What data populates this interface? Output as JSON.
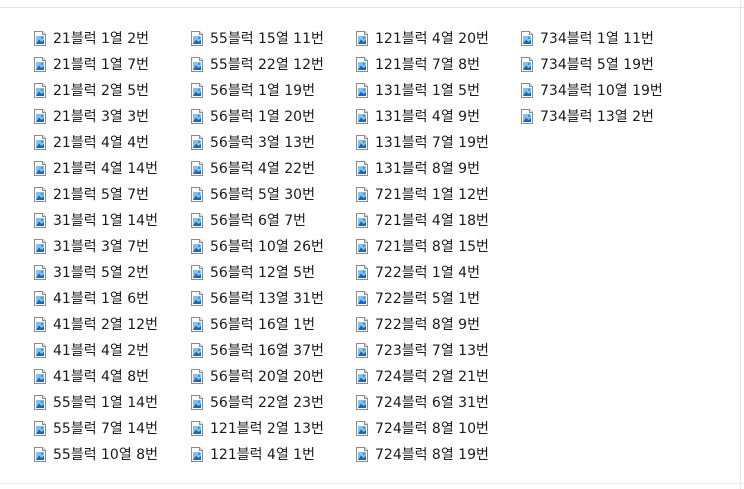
{
  "files": {
    "columns": [
      [
        {
          "name": "21블럭 1열 2번",
          "icon": "image-file-icon"
        },
        {
          "name": "21블럭 1열 7번",
          "icon": "image-file-icon"
        },
        {
          "name": "21블럭 2열 5번",
          "icon": "image-file-icon"
        },
        {
          "name": "21블럭 3열 3번",
          "icon": "image-file-icon"
        },
        {
          "name": "21블럭 4열 4번",
          "icon": "image-file-icon"
        },
        {
          "name": "21블럭 4열 14번",
          "icon": "image-file-icon"
        },
        {
          "name": "21블럭 5열 7번",
          "icon": "image-file-icon"
        },
        {
          "name": "31블럭 1열 14번",
          "icon": "image-file-icon"
        },
        {
          "name": "31블럭 3열 7번",
          "icon": "image-file-icon"
        },
        {
          "name": "31블럭 5열 2번",
          "icon": "image-file-icon"
        },
        {
          "name": "41블럭 1열 6번",
          "icon": "image-file-icon"
        },
        {
          "name": "41블럭 2열 12번",
          "icon": "image-file-icon"
        },
        {
          "name": "41블럭 4열 2번",
          "icon": "image-file-icon"
        },
        {
          "name": "41블럭 4열 8번",
          "icon": "image-file-icon"
        },
        {
          "name": "55블럭 1열 14번",
          "icon": "image-file-icon"
        },
        {
          "name": "55블럭 7열 14번",
          "icon": "image-file-icon"
        },
        {
          "name": "55블럭 10열 8번",
          "icon": "image-file-icon"
        }
      ],
      [
        {
          "name": "55블럭 15열 11번",
          "icon": "image-file-icon"
        },
        {
          "name": "55블럭 22열 12번",
          "icon": "image-file-icon"
        },
        {
          "name": "56블럭 1열 19번",
          "icon": "image-file-icon"
        },
        {
          "name": "56블럭 1열 20번",
          "icon": "image-file-icon"
        },
        {
          "name": "56블럭 3열 13번",
          "icon": "image-file-icon"
        },
        {
          "name": "56블럭 4열 22번",
          "icon": "image-file-icon"
        },
        {
          "name": "56블럭 5열 30번",
          "icon": "image-file-icon"
        },
        {
          "name": "56블럭 6열 7번",
          "icon": "image-file-icon"
        },
        {
          "name": "56블럭 10열 26번",
          "icon": "image-file-icon"
        },
        {
          "name": "56블럭 12열 5번",
          "icon": "image-file-icon"
        },
        {
          "name": "56블럭 13열 31번",
          "icon": "image-file-icon"
        },
        {
          "name": "56블럭 16열 1번",
          "icon": "image-file-icon"
        },
        {
          "name": "56블럭 16열 37번",
          "icon": "image-file-icon"
        },
        {
          "name": "56블럭 20열 20번",
          "icon": "image-file-icon"
        },
        {
          "name": "56블럭 22열 23번",
          "icon": "image-file-icon"
        },
        {
          "name": "121블럭 2열 13번",
          "icon": "image-file-icon"
        },
        {
          "name": "121블럭 4열 1번",
          "icon": "image-file-icon"
        }
      ],
      [
        {
          "name": "121블럭 4열 20번",
          "icon": "image-file-icon"
        },
        {
          "name": "121블럭 7열 8번",
          "icon": "image-file-icon"
        },
        {
          "name": "131블럭 1열 5번",
          "icon": "image-file-icon"
        },
        {
          "name": "131블럭 4열 9번",
          "icon": "image-file-icon"
        },
        {
          "name": "131블럭 7열 19번",
          "icon": "image-file-icon"
        },
        {
          "name": "131블럭 8열 9번",
          "icon": "image-file-icon"
        },
        {
          "name": "721블럭 1열 12번",
          "icon": "image-file-icon"
        },
        {
          "name": "721블럭 4열 18번",
          "icon": "image-file-icon"
        },
        {
          "name": "721블럭 8열 15번",
          "icon": "image-file-icon"
        },
        {
          "name": "722블럭 1열 4번",
          "icon": "image-file-icon"
        },
        {
          "name": "722블럭 5열 1번",
          "icon": "image-file-icon"
        },
        {
          "name": "722블럭 8열 9번",
          "icon": "image-file-icon"
        },
        {
          "name": "723블럭 7열 13번",
          "icon": "image-file-icon"
        },
        {
          "name": "724블럭 2열 21번",
          "icon": "image-file-icon"
        },
        {
          "name": "724블럭 6열 31번",
          "icon": "image-file-icon"
        },
        {
          "name": "724블럭 8열 10번",
          "icon": "image-file-icon"
        },
        {
          "name": "724블럭 8열 19번",
          "icon": "image-file-icon"
        }
      ],
      [
        {
          "name": "734블럭 1열 11번",
          "icon": "image-file-icon"
        },
        {
          "name": "734블럭 5열 19번",
          "icon": "image-file-icon"
        },
        {
          "name": "734블럭 10열 19번",
          "icon": "image-file-icon"
        },
        {
          "name": "734블럭 13열 2번",
          "icon": "image-file-icon"
        }
      ]
    ]
  },
  "colors": {
    "icon_sky": "#7ec3f0",
    "icon_deep": "#1b65b8",
    "icon_mid": "#3b8fd9",
    "icon_border": "#8a8a8a",
    "text": "#1a1a1a"
  }
}
